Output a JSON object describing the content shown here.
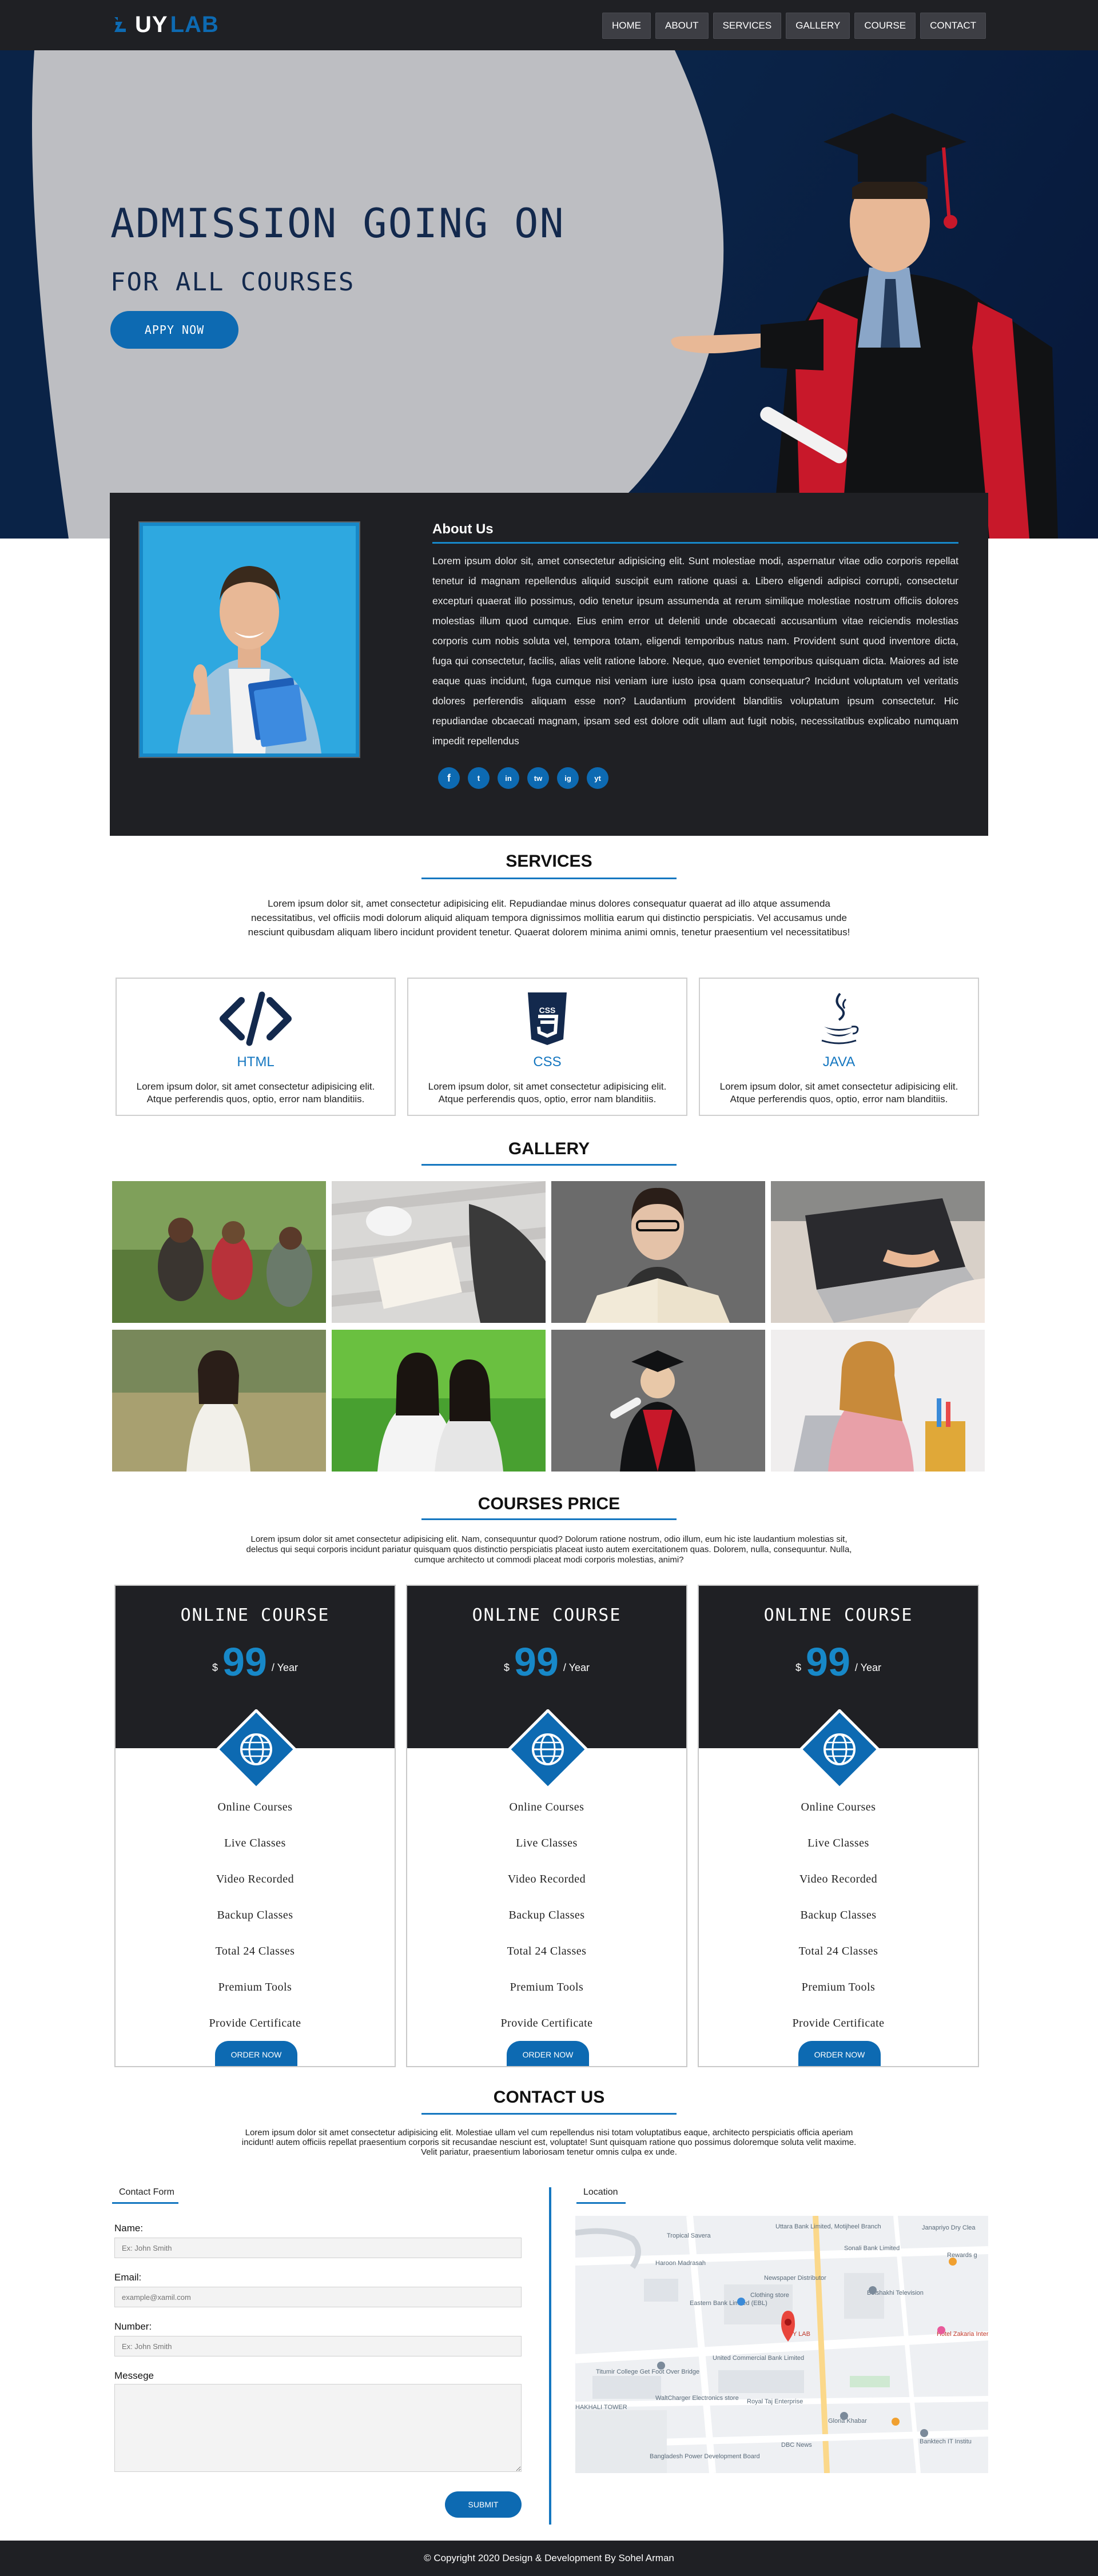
{
  "header": {
    "logo_uy": "UY",
    "logo_lab": "LAB",
    "nav": [
      "HOME",
      "ABOUT",
      "SERVICES",
      "GALLERY",
      "COURSE",
      "CONTACT"
    ]
  },
  "hero": {
    "title": "ADMISSION GOING ON",
    "subtitle": "FOR ALL COURSES",
    "button": "APPY NOW"
  },
  "about": {
    "title": "About Us",
    "text": "Lorem ipsum dolor sit, amet consectetur adipisicing elit. Sunt molestiae modi, aspernatur vitae odio corporis repellat tenetur id magnam repellendus aliquid suscipit eum ratione quasi a. Libero eligendi adipisci corrupti, consectetur excepturi quaerat illo possimus, odio tenetur ipsum assumenda at rerum similique molestiae nostrum officiis dolores molestias illum quod cumque. Eius enim error ut deleniti unde obcaecati accusantium vitae reiciendis molestias corporis cum nobis soluta vel, tempora totam, eligendi temporibus natus nam. Provident sunt quod inventore dicta, fuga qui consectetur, facilis, alias velit ratione labore. Neque, quo eveniet temporibus quisquam dicta. Maiores ad iste eaque quas incidunt, fuga cumque nisi veniam iure iusto ipsa quam consequatur? Incidunt voluptatum vel veritatis dolores perferendis aliquam esse non? Laudantium provident blanditiis voluptatum ipsum consectetur. Hic repudiandae obcaecati magnam, ipsam sed est dolore odit ullam aut fugit nobis, necessitatibus explicabo numquam impedit repellendus",
    "social": [
      "f",
      "t",
      "in",
      "tw",
      "ig",
      "yt"
    ]
  },
  "services": {
    "title": "SERVICES",
    "intro": "Lorem ipsum dolor sit, amet consectetur adipisicing elit. Repudiandae minus dolores consequatur quaerat ad illo atque assumenda necessitatibus, vel officiis modi dolorum aliquid aliquam tempora dignissimos mollitia earum qui distinctio perspiciatis. Vel accusamus unde nesciunt quibusdam aliquam libero incidunt provident tenetur. Quaerat dolorem minima animi omnis, tenetur praesentium vel necessitatibus!",
    "cards": [
      {
        "name": "HTML",
        "desc": "Lorem ipsum dolor, sit amet consectetur adipisicing elit. Atque perferendis quos, optio, error nam blanditiis."
      },
      {
        "name": "CSS",
        "desc": "Lorem ipsum dolor, sit amet consectetur adipisicing elit. Atque perferendis quos, optio, error nam blanditiis."
      },
      {
        "name": "JAVA",
        "desc": "Lorem ipsum dolor, sit amet consectetur adipisicing elit. Atque perferendis quos, optio, error nam blanditiis."
      }
    ]
  },
  "gallery": {
    "title": "GALLERY"
  },
  "courses": {
    "title": "COURSES PRICE",
    "intro": "Lorem ipsum dolor sit amet consectetur adipisicing elit. Nam, consequuntur quod? Dolorum ratione nostrum, odio illum, eum hic iste laudantium molestias sit, delectus qui sequi corporis incidunt pariatur quisquam quos distinctio perspiciatis placeat iusto autem exercitationem quas. Dolorem, nulla, consequuntur. Nulla, cumque architecto ut commodi placeat modi corporis molestias, animi?",
    "cards": [
      {
        "name": "ONLINE COURSE",
        "currency": "$",
        "price": "99",
        "period": "/ Year",
        "button": "ORDER NOW"
      },
      {
        "name": "ONLINE COURSE",
        "currency": "$",
        "price": "99",
        "period": "/ Year",
        "button": "ORDER NOW"
      },
      {
        "name": "ONLINE COURSE",
        "currency": "$",
        "price": "99",
        "period": "/ Year",
        "button": "ORDER NOW"
      }
    ],
    "features": [
      "Online Courses",
      "Live Classes",
      "Video Recorded",
      "Backup Classes",
      "Total 24 Classes",
      "Premium Tools",
      "Provide Certificate"
    ]
  },
  "contact": {
    "title": "CONTACT US",
    "intro": "Lorem ipsum dolor sit amet consectetur adipisicing elit. Molestiae ullam vel cum repellendus nisi totam voluptatibus eaque, architecto perspiciatis officia aperiam incidunt! autem officiis repellat praesentium corporis sit recusandae nesciunt est, voluptate! Sunt quisquam ratione quo possimus doloremque soluta velit maxime. Velit pariatur, praesentium laboriosam tenetur omnis culpa ex unde.",
    "form_tab": "Contact Form",
    "location_tab": "Location",
    "fields": [
      {
        "label": "Name:",
        "placeholder": "Ex: John Smith"
      },
      {
        "label": "Email:",
        "placeholder": "example@xamil.com"
      },
      {
        "label": "Number:",
        "placeholder": "Ex: John Smith"
      }
    ],
    "message_label": "Messege",
    "submit": "SUBMIT",
    "map_labels": [
      "Uttara Bank Limited, Motijheel Branch",
      "Janapriyo Dry Clea",
      "Tropical Savera",
      "Sonali Bank Limited",
      "Rewards g",
      "Haroon Madrasah",
      "Newspaper Distributor",
      "Boishakhi Television",
      "Clothing store",
      "Eastern Bank Limited (EBL)",
      "UY LAB",
      "Hotel Zakaria International",
      "United Commercial Bank Limited",
      "Titumir College Get Foot Over Bridge",
      "WaltCharger Electronics store",
      "Royal Taj Enterprise",
      "HAKHALI TOWER",
      "Gloria Khabar",
      "Bangladesh Power Development Board",
      "DBC News",
      "Banktech IT Institu"
    ]
  },
  "footer": {
    "text": "© Copyright 2020 Design & Development By Sohel Arman"
  }
}
